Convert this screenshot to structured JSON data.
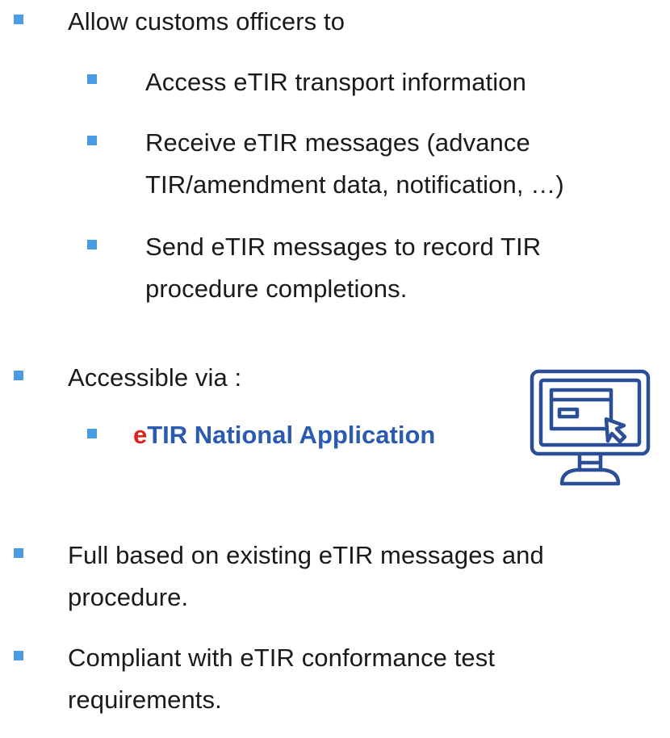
{
  "colors": {
    "bullet": "#4a9de4",
    "text": "#1a1a1a",
    "accent_red": "#e0201b",
    "accent_blue": "#2a5bb0",
    "icon_stroke": "#2a4f96"
  },
  "items": {
    "allow_title": "Allow customs officers to",
    "access": "Access eTIR transport information",
    "receive_line1": "Receive eTIR messages (advance",
    "receive_line2": "TIR/amendment data, notification, …)",
    "send_line1": "Send eTIR messages to record TIR",
    "send_line2": "procedure completions.",
    "accessible_title": "Accessible via :",
    "app_prefix": "e",
    "app_rest": "TIR National Application",
    "full_line1": "Full based on existing eTIR messages and",
    "full_line2": "procedure.",
    "compliant_line1": "Compliant with eTIR conformance test",
    "compliant_line2": "requirements."
  },
  "icons": {
    "bullet": "square-bullet-icon",
    "monitor": "computer-monitor-icon"
  }
}
